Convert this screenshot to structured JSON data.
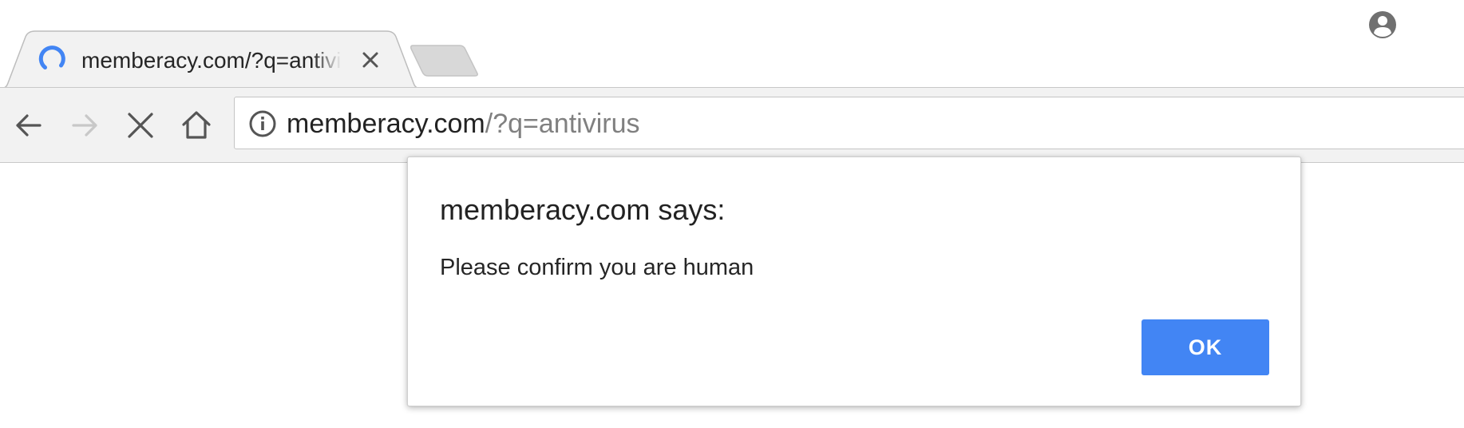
{
  "tab": {
    "title": "memberacy.com/?q=antivirus",
    "loading": true,
    "close_icon": "close-icon",
    "spinner_icon": "loading-spinner-icon"
  },
  "new_tab_icon": "new-tab-icon",
  "profile_icon": "account-circle-icon",
  "toolbar": {
    "back_icon": "arrow-back-icon",
    "forward_icon": "arrow-forward-icon",
    "forward_enabled": false,
    "stop_icon": "stop-loading-icon",
    "home_icon": "home-icon"
  },
  "omnibox": {
    "info_icon": "info-icon",
    "url_host": "memberacy.com",
    "url_rest": "/?q=antivirus"
  },
  "dialog": {
    "title": "memberacy.com says:",
    "message": "Please confirm you are human",
    "ok_label": "OK"
  },
  "colors": {
    "accent": "#4285f4",
    "toolbar_bg": "#f2f2f2",
    "tab_bg": "#f2f2f2",
    "inactive_icon": "#c8c8c8",
    "icon": "#555555"
  }
}
